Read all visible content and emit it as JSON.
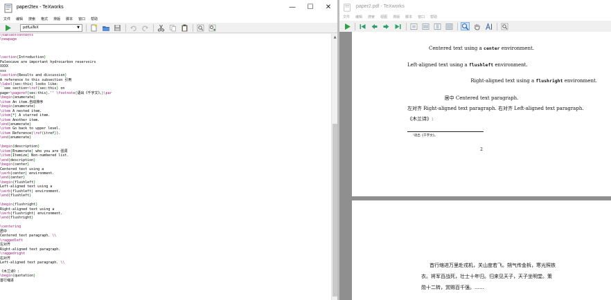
{
  "editor_window": {
    "title": "paper2tex - TeXworks",
    "controls": {
      "minimize": "—",
      "maximize": "☐",
      "close": "✕"
    },
    "menu": [
      "文件",
      "编辑",
      "搜索",
      "格式",
      "排版",
      "脚本",
      "窗口",
      "帮助"
    ],
    "engine": "pdfLaTeX",
    "icons": [
      "run-icon",
      "new-file-icon",
      "open-folder-icon",
      "save-icon",
      "undo-icon",
      "redo-icon",
      "cut-icon",
      "copy-icon",
      "paste-icon",
      "find-icon",
      "replace-icon"
    ],
    "lines": [
      "\\tableofcontents",
      "\\newpage",
      "",
      "",
      "",
      "\\section{Introduction}",
      "Paleocave are important hydrocarbon reservoirs",
      "XXXX",
      "xxx",
      "\\section{Results and discussion}",
      "A reference to this subsection 引用",
      "\\label{sec:this} looks like:",
      "``see section~\\ref{sec:this} on",
      "page~\\pageref{sec:this}.'' \\footnote{语出《千字文》。}\\par",
      "\\begin{enumerate}",
      "\\item An item.自动排序",
      "\\begin{enumerate}",
      "\\item A nested item.",
      "\\item[*] A starred item.",
      "\\item Another item.",
      "\\end{enumerate}",
      "\\item Go back to upper level.",
      "\\item Reference(\\ref{itref}).",
      "\\end{enumerate}",
      "",
      "\\begin{description}",
      "\\item[Enumerate] who you are 强调",
      "\\item[Itemize] Non-numbered list.",
      "\\end{description}",
      "\\begin{center}",
      "Centered text using a",
      "\\verb|center| environment.",
      "\\end{center}",
      "\\begin{flushleft}",
      "Left-aligned text using a",
      "\\verb|flushleft| environment.",
      "\\end{flushleft}",
      "",
      "\\begin{flushright}",
      "Right-aligned text using a",
      "\\verb|flushright| environment.",
      "\\end{flushright}",
      "",
      "\\centering",
      "居中",
      "Centered text paragraph. \\\\",
      "\\raggedleft",
      "左对齐",
      "Right-aligned text paragraph.",
      "\\raggedright",
      "右对齐",
      "Left-aligned text paragraph. \\\\",
      "",
      "《木兰诗》:",
      "\\begin{quotation}",
      "首行缩进"
    ]
  },
  "viewer_window": {
    "title": "paper2.pdf - TeXworks",
    "menu": [
      "文件",
      "编辑",
      "搜索",
      "视图",
      "排版",
      "脚本",
      "窗口",
      "帮助"
    ],
    "icons": [
      "run-icon",
      "first-page-icon",
      "prev-page-icon",
      "next-page-icon",
      "last-page-icon",
      "actual-size-icon",
      "fit-width-icon",
      "fit-page-icon",
      "fit-window-icon",
      "magnify-icon",
      "hand-icon",
      "text-select-icon",
      "find-icon"
    ],
    "page1": {
      "lines": [
        {
          "pre": "Centered text using a ",
          "code": "center",
          "post": " environment."
        },
        {
          "pre": "Left-aligned text using a ",
          "code": "flushleft",
          "post": " environment."
        },
        {
          "pre": "Right-aligned text using a ",
          "code": "flushright",
          "post": " environment."
        },
        {
          "pre": "居中 Centered text paragraph.",
          "code": "",
          "post": ""
        },
        {
          "pre": "左对齐 Right-aligned text paragraph. 右对齐 Left-aligned text paragraph.",
          "code": "",
          "post": ""
        },
        {
          "pre": "《木兰诗》:",
          "code": "",
          "post": ""
        }
      ],
      "footnote": "¹语出《千字文》。",
      "page_number": "2"
    },
    "page2": {
      "lines": [
        "首行缩进万里赴戎机，关山度若飞。朔气传金柝，寒光照铁",
        "衣。将军百战死，壮士十年归。归来见天子，天子坐明堂。策",
        "勋十二转，赏赐百千强。……"
      ]
    }
  }
}
